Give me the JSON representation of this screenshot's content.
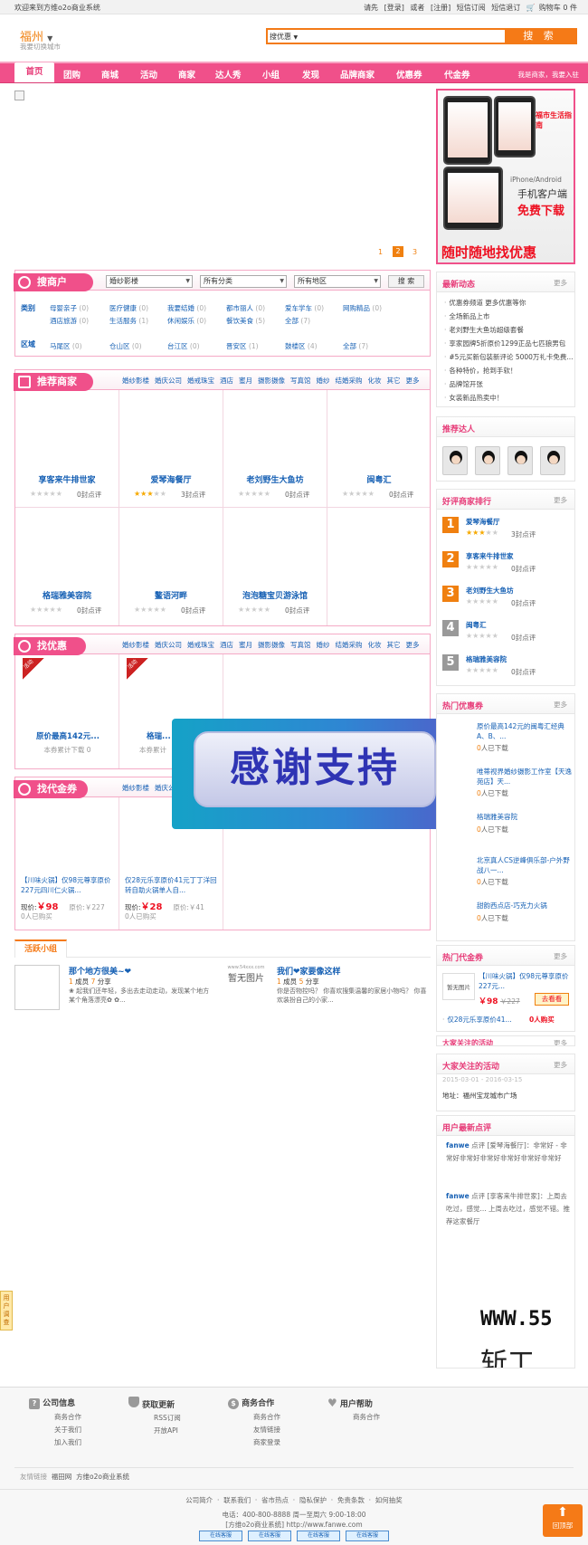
{
  "topbar": {
    "welcome": "欢迎来到方维o2o商业系统",
    "please": "请先",
    "login": "[登录]",
    "or": "或者",
    "register": "[注册]",
    "sms_sub": "短信订阅",
    "sms_unsub": "短信退订",
    "cart": "购物车 0 件"
  },
  "header": {
    "city": "福州",
    "city_switch": "我要切换城市",
    "search_type": "搜优惠",
    "search_button": "搜 索"
  },
  "nav": {
    "items": [
      "首页",
      "团购",
      "商城",
      "活动",
      "商家",
      "达人秀",
      "小组",
      "发现",
      "品牌商家",
      "优惠券",
      "代金券"
    ],
    "right": "我是商家，我要入驻"
  },
  "banner": {
    "pages": [
      "1",
      "2",
      "3"
    ],
    "current": "2"
  },
  "app_promo": {
    "line1": "iPhone/Android",
    "line2": "手机客户端",
    "line3": "免费下载",
    "slogan": "随时随地找优惠",
    "screen_title": "福市生活指南"
  },
  "search_shop": {
    "title": "搜商户",
    "dd1": "婚纱影楼",
    "dd2": "所有分类",
    "dd3": "所有地区",
    "button": "搜 索",
    "cat_label": "类别",
    "cats": [
      {
        "n": "母婴亲子",
        "c": "(0)"
      },
      {
        "n": "医疗健康",
        "c": "(0)"
      },
      {
        "n": "我要结婚",
        "c": "(0)"
      },
      {
        "n": "都市丽人",
        "c": "(0)"
      },
      {
        "n": "爱车学车",
        "c": "(0)"
      },
      {
        "n": "网购精品",
        "c": "(0)"
      },
      {
        "n": "酒店旅游",
        "c": "(0)"
      },
      {
        "n": "生活服务",
        "c": "(1)"
      },
      {
        "n": "休闲娱乐",
        "c": "(0)"
      },
      {
        "n": "餐饮美食",
        "c": "(5)"
      },
      {
        "n": "全部",
        "c": "(7)"
      }
    ],
    "area_label": "区域",
    "areas": [
      {
        "n": "马尾区",
        "c": "(0)"
      },
      {
        "n": "仓山区",
        "c": "(0)"
      },
      {
        "n": "台江区",
        "c": "(0)"
      },
      {
        "n": "晋安区",
        "c": "(1)"
      },
      {
        "n": "鼓楼区",
        "c": "(4)"
      },
      {
        "n": "全部",
        "c": "(7)"
      }
    ]
  },
  "rec_shops": {
    "title": "推荐商家",
    "links": [
      "婚纱影楼",
      "婚庆公司",
      "婚戒珠宝",
      "酒店",
      "蜜月",
      "摄影摄像",
      "写真馆",
      "婚纱",
      "结婚采购",
      "化妆",
      "其它",
      "更多"
    ],
    "shops": [
      {
        "name": "享客来牛排世家",
        "stars": 0,
        "reviews": "0封点评"
      },
      {
        "name": "爱琴海餐厅",
        "stars": 3,
        "reviews": "3封点评"
      },
      {
        "name": "老刘野生大鱼坊",
        "stars": 0,
        "reviews": "0封点评"
      },
      {
        "name": "闽粤汇",
        "stars": 0,
        "reviews": "0封点评"
      },
      {
        "name": "格瑞雅美容院",
        "stars": 0,
        "reviews": "0封点评"
      },
      {
        "name": "鳌语河畔",
        "stars": 0,
        "reviews": "0封点评"
      },
      {
        "name": "泡泡糖宝贝游泳馆",
        "stars": 0,
        "reviews": "0封点评"
      }
    ]
  },
  "coupons": {
    "title": "找优惠",
    "links": [
      "婚纱影楼",
      "婚庆公司",
      "婚戒珠宝",
      "酒店",
      "蜜月",
      "摄影摄像",
      "写真馆",
      "婚纱",
      "结婚采购",
      "化妆",
      "其它",
      "更多"
    ],
    "items": [
      {
        "name": "原价最高142元...",
        "sub": "本券累计下载 0",
        "tag": "活动"
      },
      {
        "name": "格瑞...",
        "sub": "本券累计",
        "tag": "活动"
      }
    ]
  },
  "vouchers": {
    "title": "找代金券",
    "links": [
      "婚纱影楼",
      "婚庆公司"
    ],
    "items": [
      {
        "name": "【川味火锅】仅98元尊享原价227元四川仁火锅...",
        "now_label": "现价:",
        "now": "￥98",
        "orig_label": "原价:",
        "orig": "￥227",
        "sold": "0人已购买"
      },
      {
        "name": "仅28元乐享原价41元丁丁洋回转自助火锅单人自...",
        "now_label": "现价:",
        "now": "￥28",
        "orig_label": "原价:",
        "orig": "￥41",
        "sold": "0人已购买"
      }
    ]
  },
  "groups": {
    "tab": "活跃小组",
    "items": [
      {
        "title": "那个地方很美~❤",
        "members": "1",
        "mem_label": "成员",
        "topics": "7",
        "top_label": "分享",
        "desc": "❀ 起我们还年轻，多出去走动走动，发现某个地方 某个角落漂亮✿ ✿..."
      },
      {
        "title": "我们❤家要像这样",
        "members": "1",
        "mem_label": "成员",
        "topics": "5",
        "top_label": "分享",
        "desc": "你是否物控吗？ 你喜欢搜集温馨的家居小物吗？ 你喜欢装扮自己的小家..."
      }
    ],
    "noimg": "暂无图片",
    "noimg_site": "www.54xxx.com"
  },
  "overlay": {
    "text": "感谢支持"
  },
  "sidebar": {
    "news": {
      "title": "最新动态",
      "more": "更多",
      "items": [
        "优惠券频道 更多优惠等你",
        "全场新品上市",
        "老刘野生大鱼坊超级套餐",
        "享家园牌5折原价1299正品七匹狼男包",
        "#5元买新包装新评论 5000万礼卡免费...",
        "各种特价，抢到手软！",
        "品牌馆开张",
        "女装新品热卖中！"
      ]
    },
    "daren": {
      "title": "推荐达人"
    },
    "rank": {
      "title": "好评商家排行",
      "more": "更多",
      "items": [
        {
          "n": "1",
          "name": "爱琴海餐厅",
          "stars": 3,
          "rv": "3封点评"
        },
        {
          "n": "2",
          "name": "享客来牛排世家",
          "stars": 0,
          "rv": "0封点评"
        },
        {
          "n": "3",
          "name": "老刘野生大鱼坊",
          "stars": 0,
          "rv": "0封点评"
        },
        {
          "n": "4",
          "name": "闽粤汇",
          "stars": 0,
          "rv": "0封点评"
        },
        {
          "n": "5",
          "name": "格瑞雅美容院",
          "stars": 0,
          "rv": "0封点评"
        }
      ]
    },
    "hotcoupon": {
      "title": "热门优惠券",
      "more": "更多",
      "items": [
        {
          "name": "原价最高142元的闽粤汇经典A、B、...",
          "dl": "人已下载",
          "cnt": "0"
        },
        {
          "name": "唯蒂视界婚纱摄影工作室【天逸苑店】天...",
          "dl": "人已下载",
          "cnt": "0"
        },
        {
          "name": "格瑞雅美容院",
          "dl": "人已下载",
          "cnt": "0"
        },
        {
          "name": "北京真人CS逆峰俱乐部-户外野战八一...",
          "dl": "人已下载",
          "cnt": "0"
        },
        {
          "name": "甜韵西点店-巧克力火锅",
          "dl": "人已下载",
          "cnt": "0"
        }
      ]
    },
    "hotvoucher": {
      "title": "热门代金券",
      "more": "更多",
      "name": "【川味火锅】仅98元尊享原价227元...",
      "price": "￥98",
      "orig": "￥227",
      "btn": "去看看",
      "noimg": "暂无图片",
      "line2": "仅28元乐享原价41...",
      "buy": "0人购买"
    },
    "attention_ghost": {
      "title": "大家关注的活动",
      "more": "更多"
    },
    "attention": {
      "title": "大家关注的活动",
      "more": "更多",
      "addr_label": "地址：",
      "addr": "福州宝龙城市广场",
      "date": "2015-03-01 - 2016-03-15"
    },
    "reviews": {
      "title": "用户最新点评",
      "items": [
        {
          "user": "fanwe",
          "txt": "点评 [爱琴海餐厅]：非常好 - 非常好非常好非常好非常好非常好非常好"
        },
        {
          "user": "fanwe",
          "txt": "点评 [享客来牛排世家]：上周去吃过，感觉... 上周去吃过，感觉不错。推荐这家餐厅"
        }
      ]
    },
    "watermark1": "WWW.55",
    "watermark2": "斩工"
  },
  "float_survey": "用户调查",
  "footer": {
    "cols": [
      {
        "h": "公司信息",
        "items": [
          "商务合作",
          "关于我们",
          "加入我们"
        ]
      },
      {
        "h": "获取更新",
        "items": [
          "RSS订阅",
          "开放API"
        ]
      },
      {
        "h": "商务合作",
        "items": [
          "商务合作",
          "友情链接",
          "商家登录"
        ]
      },
      {
        "h": "用户帮助",
        "items": [
          "商务合作"
        ]
      }
    ],
    "friend_label": "友情链接",
    "friends": [
      "福田网",
      "方维o2o商业系统"
    ],
    "links": [
      "公司简介",
      "联系我们",
      "省市热点",
      "隐私保护",
      "免责条款",
      "如何抽奖"
    ],
    "tel": "电话：400-800-8888 周一至周六 9:00-18:00",
    "copy": "[方维o2o商业系统] http://www.fanwe.com",
    "badges": [
      "在线客服",
      "在线客服",
      "在线客服",
      "在线客服"
    ],
    "back_top": "回顶部"
  },
  "colors": {
    "pink": "#f0508a",
    "orange": "#f57a17",
    "blue": "#1660b4",
    "red": "#e12"
  }
}
